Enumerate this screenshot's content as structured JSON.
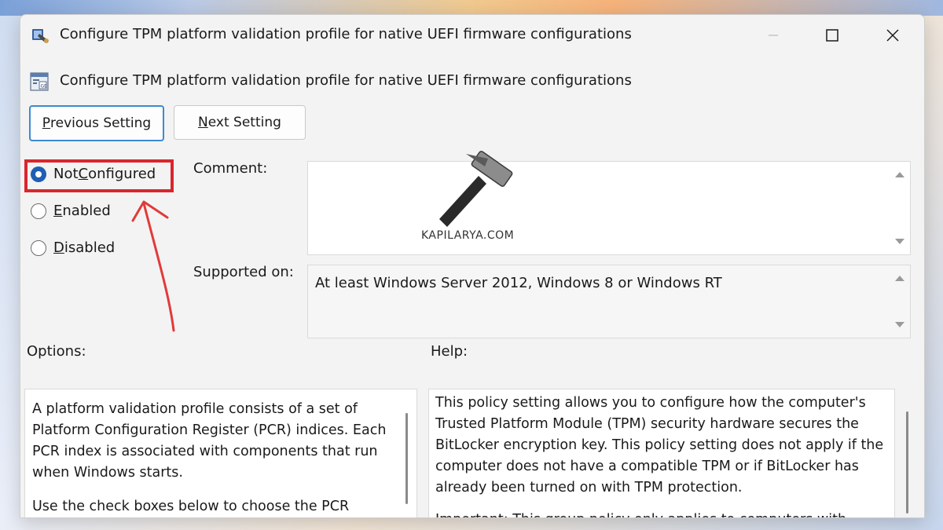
{
  "window": {
    "title": "Configure TPM platform validation profile for native UEFI firmware configurations",
    "header": "Configure TPM platform validation profile for native UEFI firmware configurations"
  },
  "nav": {
    "previous_prefix": "P",
    "previous_rest": "revious Setting",
    "next_prefix": "N",
    "next_rest": "ext Setting"
  },
  "state": {
    "not_configured_pre": "Not ",
    "not_configured_ul": "C",
    "not_configured_post": "onfigured",
    "enabled_ul": "E",
    "enabled_post": "nabled",
    "disabled_ul": "D",
    "disabled_post": "isabled",
    "selected": "Not Configured"
  },
  "labels": {
    "comment": "Comment:",
    "supported_on": "Supported on:",
    "options": "Options:",
    "help": "Help:"
  },
  "supported_value": "At least Windows Server 2012, Windows 8 or Windows RT",
  "comment_value": "",
  "watermark": "KAPILARYA.COM",
  "options_text": {
    "lines": [
      "A platform validation profile consists of a set of",
      "Platform Configuration Register (PCR) indices. Each",
      "PCR index is associated with components that run",
      "when Windows starts."
    ],
    "para2": "Use the check boxes below to choose the PCR"
  },
  "help_text": {
    "lines": [
      "This policy setting allows you to configure how the computer's",
      "Trusted Platform Module (TPM) security hardware secures the",
      "BitLocker encryption key. This policy setting does not apply if the",
      "computer does not have a compatible TPM or if BitLocker has",
      "already been turned on with TPM protection."
    ],
    "para2": "Important: This group policy only applies to computers with"
  },
  "colors": {
    "highlight": "#d9262d",
    "accent": "#1e5fb3"
  },
  "icons": [
    "policy-app-icon",
    "policy-setting-icon",
    "minimize-icon",
    "maximize-icon",
    "close-icon",
    "hammer-icon",
    "arrow-annotation",
    "scroll-up-icon",
    "scroll-down-icon"
  ]
}
